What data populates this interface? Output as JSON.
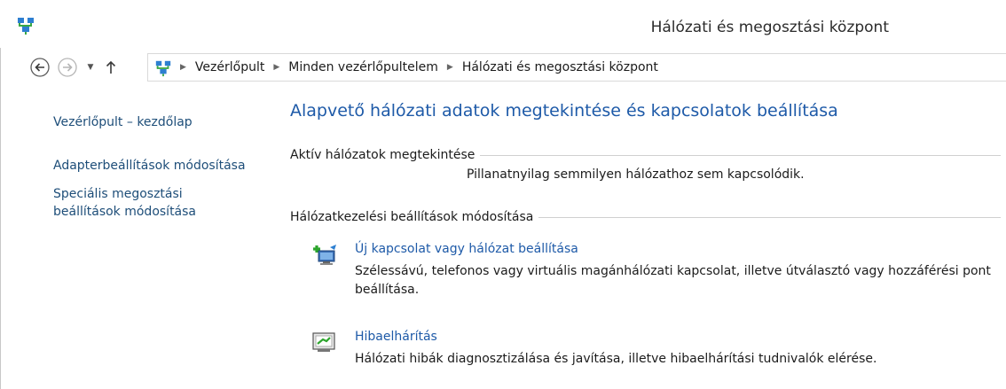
{
  "window": {
    "title": "Hálózati és megosztási központ",
    "icon": "network-center-icon"
  },
  "navigation": {
    "back_icon": "back-arrow-icon",
    "forward_icon": "forward-arrow-icon",
    "dropdown_icon": "chevron-down-icon",
    "up_icon": "up-arrow-icon",
    "breadcrumb": [
      "Vezérlőpult",
      "Minden vezérlőpultelem",
      "Hálózati és megosztási központ"
    ]
  },
  "sidebar": {
    "links": [
      "Vezérlőpult – kezdőlap",
      "Adapterbeállítások módosítása",
      "Speciális megosztási beállítások módosítása"
    ]
  },
  "main": {
    "heading": "Alapvető hálózati adatok megtekintése és kapcsolatok beállítása",
    "active_networks": {
      "label": "Aktív hálózatok megtekintése",
      "status": "Pillanatnyilag semmilyen hálózathoz sem kapcsolódik."
    },
    "settings": {
      "label": "Hálózatkezelési beállítások módosítása",
      "tasks": [
        {
          "icon": "new-connection-icon",
          "title": "Új kapcsolat vagy hálózat beállítása",
          "description": "Szélessávú, telefonos vagy virtuális magánhálózati kapcsolat, illetve útválasztó vagy hozzáférési pont beállítása."
        },
        {
          "icon": "troubleshoot-icon",
          "title": "Hibaelhárítás",
          "description": "Hálózati hibák diagnosztizálása és javítása, illetve hibaelhárítási tudnivalók elérése."
        }
      ]
    }
  },
  "colors": {
    "link": "#1e4e79",
    "heading": "#1e5aa8",
    "task_link": "#1e5aa8"
  }
}
